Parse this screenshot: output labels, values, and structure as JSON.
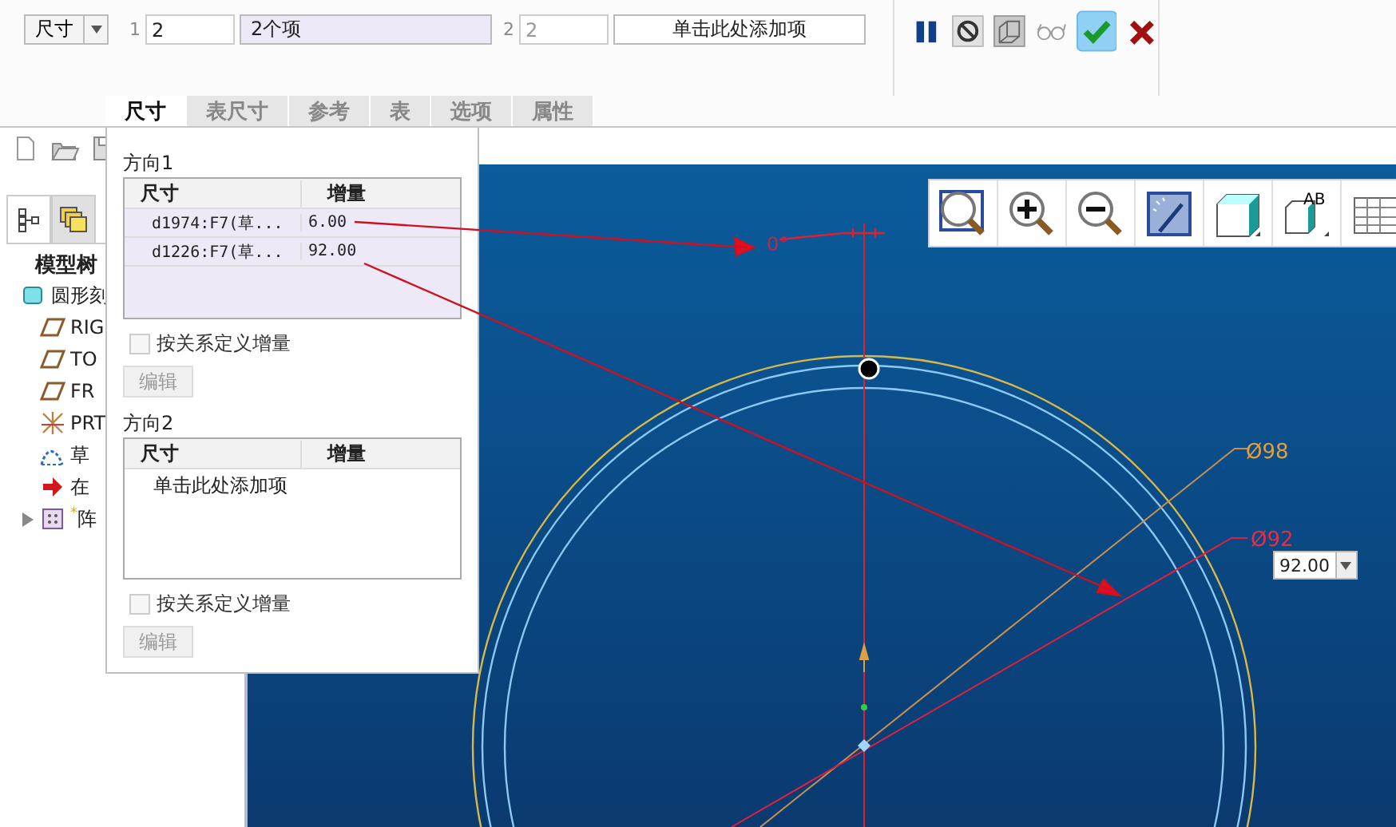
{
  "dashboard": {
    "type_dropdown": "尺寸",
    "directions": [
      {
        "number": "1",
        "count": "2",
        "count_disabled": false,
        "collector": "2个项",
        "active": true
      },
      {
        "number": "2",
        "count": "2",
        "count_disabled": true,
        "collector": "单击此处添加项",
        "active": false
      }
    ]
  },
  "tabs": [
    {
      "label": "尺寸",
      "selected": true
    },
    {
      "label": "表尺寸",
      "selected": false
    },
    {
      "label": "参考",
      "selected": false
    },
    {
      "label": "表",
      "selected": false
    },
    {
      "label": "选项",
      "selected": false
    },
    {
      "label": "属性",
      "selected": false
    }
  ],
  "model_tree": {
    "view_tabs": [
      {
        "kind": "tree",
        "selected": true
      },
      {
        "kind": "layers",
        "selected": false
      }
    ],
    "title": "模型树",
    "items": [
      {
        "label": "圆形刻",
        "kind": "part",
        "children": [
          {
            "label": "RIG",
            "kind": "plane"
          },
          {
            "label": "TO",
            "kind": "plane"
          },
          {
            "label": "FR",
            "kind": "plane"
          },
          {
            "label": "PRT",
            "kind": "csys"
          },
          {
            "label": "草",
            "kind": "sketch"
          },
          {
            "label": "在",
            "kind": "insert"
          },
          {
            "label": "$^{*}$阵",
            "kind": "pattern",
            "expanded": false
          }
        ]
      }
    ]
  },
  "pattern_panel": {
    "directions": [
      {
        "title": "方向1",
        "columns": [
          "尺寸",
          "增量"
        ],
        "active": true,
        "rows": [
          {
            "dimension": "d1974:F7(草...",
            "increment": "6.00"
          },
          {
            "dimension": "d1226:F7(草...",
            "increment": "92.00"
          }
        ],
        "relation_checkbox": {
          "label": "按关系定义增量",
          "checked": false,
          "disabled": true
        },
        "edit_button": {
          "label": "编辑",
          "disabled": true
        }
      },
      {
        "title": "方向2",
        "columns": [
          "尺寸",
          "增量"
        ],
        "active": false,
        "add_hint": "单击此处添加项",
        "relation_checkbox": {
          "label": "按关系定义增量",
          "checked": false,
          "disabled": true
        },
        "edit_button": {
          "label": "编辑",
          "disabled": true
        }
      }
    ]
  },
  "canvas": {
    "angle_label": "0°",
    "dimension_labels": [
      {
        "text": "Ø98",
        "color": "#e0a040"
      },
      {
        "text": "Ø92",
        "color": "#e0304a"
      }
    ],
    "value_field": "92.00",
    "named_view_label": "AB"
  }
}
